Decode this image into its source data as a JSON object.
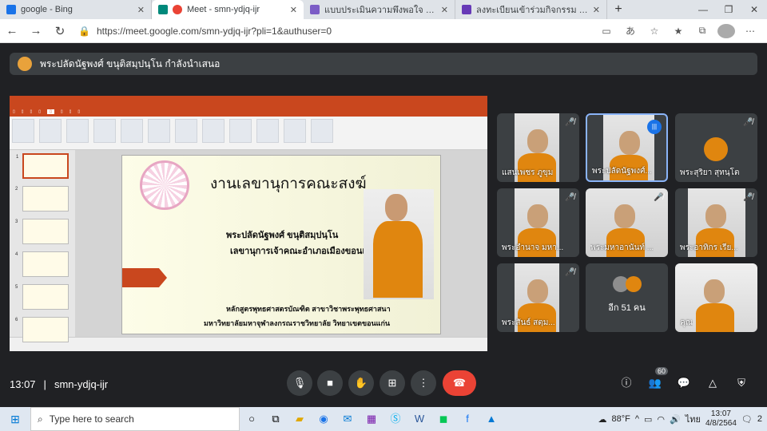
{
  "browser": {
    "tabs": [
      {
        "title": "google - Bing",
        "color": "#1a73e8",
        "active": false
      },
      {
        "title": "Meet - smn-ydjq-ijr",
        "color": "#00897b",
        "active": true
      },
      {
        "title": "แบบประเมินความพึงพอใจ กิจกรรม พระ",
        "color": "#7b5cc6",
        "active": false
      },
      {
        "title": "ลงทะเบียนเข้าร่วมกิจกรรม พระสงฆ์ : ",
        "color": "#673ab7",
        "active": false
      }
    ],
    "url": "https://meet.google.com/smn-ydjq-ijr?pli=1&authuser=0"
  },
  "banner": {
    "text": "พระปลัดนัฐพงศ์ ขนุติสมฺปนฺโน กำลังนำเสนอ"
  },
  "slide": {
    "title": "งานเลขานุการคณะสงฆ์",
    "name": "พระปลัดนัฐพงศ์ ขนุติสมฺปนฺโน",
    "position": "เลขานุการเจ้าคณะอำเภอเมืองขอนแก่น",
    "footer1": "หลักสูตรพุทธศาสตรบัณฑิต สาขาวิชาพระพุทธศาสนา",
    "footer2": "มหาวิทยาลัยมหาจุฬาลงกรณราชวิทยาลัย วิทยาเขตขอนแก่น",
    "thumb_numbers": [
      "1",
      "2",
      "3",
      "4",
      "5",
      "6"
    ]
  },
  "participants": [
    {
      "name": "แสนเพชร ภูขุม",
      "muted": true
    },
    {
      "name": "พระปลัดนัฐพงศ์...",
      "muted": false,
      "speaking": true
    },
    {
      "name": "พระสุริยา สุทนฺโต",
      "muted": true,
      "avatar": true
    },
    {
      "name": "พระอำนาจ มหา...",
      "muted": true
    },
    {
      "name": "พระมหาอานันท์ ...",
      "muted": true
    },
    {
      "name": "พระอาทิกร เรีย...",
      "muted": true
    },
    {
      "name": "พระสันธ์ สตฺม...",
      "muted": true
    },
    {
      "name": "อีก 51 คน",
      "muted": false,
      "more": true
    },
    {
      "name": "คุณ",
      "muted": false
    }
  ],
  "meeting": {
    "time": "13:07",
    "code": "smn-ydjq-ijr",
    "people_count": "60"
  },
  "taskbar": {
    "search_placeholder": "Type here to search",
    "weather": "88°F",
    "lang": "ไทย",
    "clock_time": "13:07",
    "clock_date": "4/8/2564",
    "notif": "2"
  }
}
